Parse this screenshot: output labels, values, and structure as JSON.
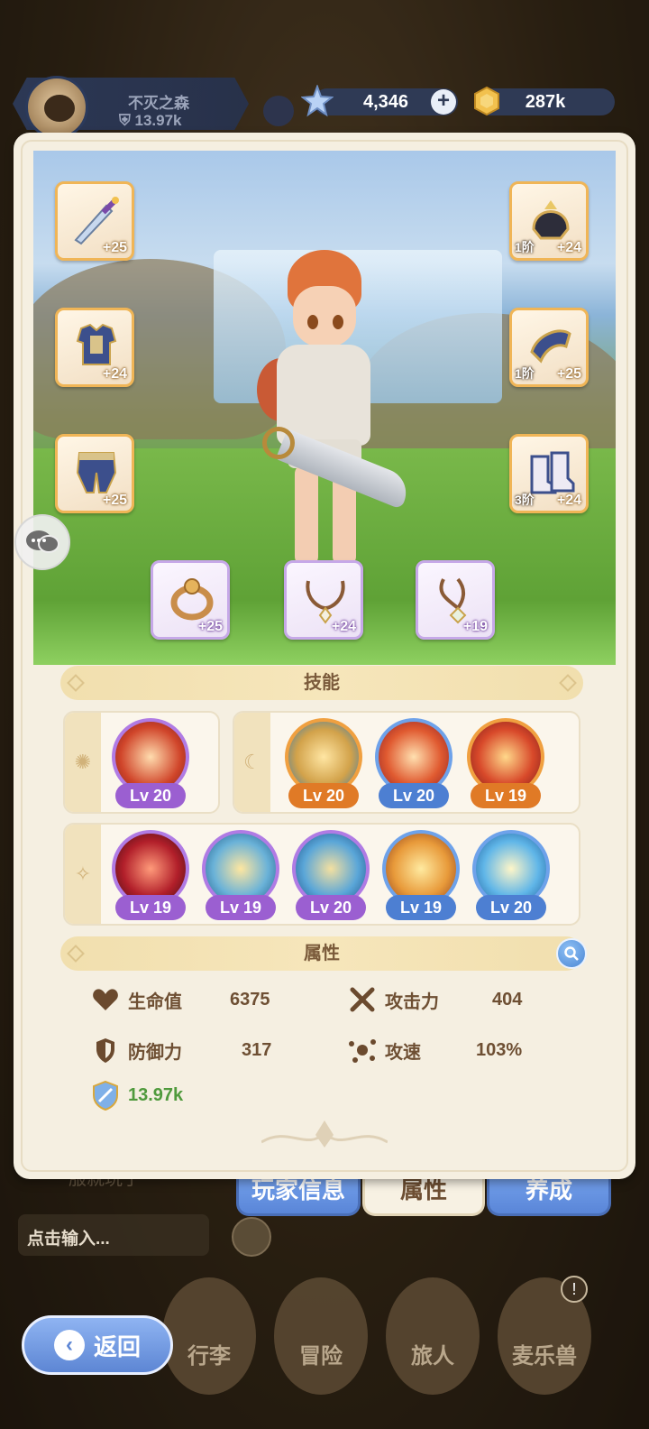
{
  "top_bar": {
    "player_name": "不灭之森",
    "player_power": "13.97k",
    "stars_amount": "4,346",
    "gold_amount": "287k"
  },
  "equipment": {
    "left": [
      {
        "name": "sword",
        "plus": "+25"
      },
      {
        "name": "armor",
        "plus": "+24"
      },
      {
        "name": "pants",
        "plus": "+25"
      }
    ],
    "right": [
      {
        "name": "helmet",
        "tier": "1阶",
        "plus": "+24"
      },
      {
        "name": "gloves",
        "tier": "1阶",
        "plus": "+25"
      },
      {
        "name": "boots",
        "tier": "3阶",
        "plus": "+24"
      }
    ],
    "bottom": [
      {
        "name": "ring",
        "plus": "+25"
      },
      {
        "name": "necklace",
        "plus": "+24"
      },
      {
        "name": "amulet",
        "plus": "+19"
      }
    ]
  },
  "skills": {
    "title": "技能",
    "sun_group": [
      {
        "level": "Lv 20",
        "color": "purple"
      }
    ],
    "moon_group": [
      {
        "level": "Lv 20",
        "color": "orange"
      },
      {
        "level": "Lv 20",
        "color": "blue"
      },
      {
        "level": "Lv 19",
        "color": "orange"
      }
    ],
    "star_group": [
      {
        "level": "Lv 19",
        "color": "purple"
      },
      {
        "level": "Lv 19",
        "color": "purple"
      },
      {
        "level": "Lv 20",
        "color": "purple"
      },
      {
        "level": "Lv 19",
        "color": "blue"
      },
      {
        "level": "Lv 20",
        "color": "blue"
      }
    ]
  },
  "attributes": {
    "title": "属性",
    "hp_label": "生命值",
    "hp_value": "6375",
    "attack_label": "攻击力",
    "attack_value": "404",
    "defense_label": "防御力",
    "defense_value": "317",
    "speed_label": "攻速",
    "speed_value": "103%",
    "power_value": "13.97k"
  },
  "tabs": [
    "玩家信息",
    "属性",
    "养成"
  ],
  "chat": {
    "hint": "服就玩了",
    "input_placeholder": "点击输入..."
  },
  "nav": [
    "行李",
    "冒险",
    "旅人",
    "麦乐兽"
  ],
  "back_label": "返回",
  "colors": {
    "accent_blue": "#5a86d8",
    "gold_border": "#f0b556",
    "panel_bg": "#f5efe1",
    "power_green": "#4f9a3c"
  }
}
